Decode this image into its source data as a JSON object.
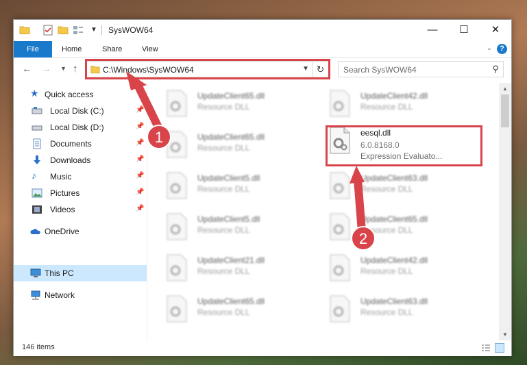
{
  "window": {
    "title": "SysWOW64"
  },
  "ribbon": {
    "tabs": {
      "file": "File",
      "home": "Home",
      "share": "Share",
      "view": "View"
    },
    "accent": "#1979ca"
  },
  "address": {
    "path": "C:\\Windows\\SysWOW64"
  },
  "search": {
    "placeholder": "Search SysWOW64"
  },
  "sidebar": {
    "quick_access": "Quick access",
    "items": [
      {
        "label": "Local Disk (C:)",
        "icon": "drive-icon",
        "pinned": true
      },
      {
        "label": "Local Disk (D:)",
        "icon": "drive-icon",
        "pinned": true
      },
      {
        "label": "Documents",
        "icon": "documents-icon",
        "pinned": true
      },
      {
        "label": "Downloads",
        "icon": "downloads-icon",
        "pinned": true
      },
      {
        "label": "Music",
        "icon": "music-icon",
        "pinned": true
      },
      {
        "label": "Pictures",
        "icon": "pictures-icon",
        "pinned": true
      },
      {
        "label": "Videos",
        "icon": "videos-icon",
        "pinned": true
      }
    ],
    "onedrive": "OneDrive",
    "this_pc": "This PC",
    "network": "Network"
  },
  "files": {
    "left": [
      {
        "name": "UpdateClient65.dll",
        "desc": "Resource DLL"
      },
      {
        "name": "UpdateClient65.dll",
        "desc": "Resource DLL"
      },
      {
        "name": "UpdateClient5.dll",
        "desc": "Resource DLL"
      },
      {
        "name": "UpdateClient5.dll",
        "desc": "Resource DLL"
      },
      {
        "name": "UpdateClient21.dll",
        "desc": "Resource DLL"
      },
      {
        "name": "UpdateClient65.dll",
        "desc": "Resource DLL"
      }
    ],
    "right": [
      {
        "name": "UpdateClient42.dll",
        "desc": "Resource DLL"
      },
      {
        "name": "UpdateClient63.dll",
        "desc": "Resource DLL"
      },
      {
        "name": "UpdateClient65.dll",
        "desc": "Resource DLL"
      },
      {
        "name": "UpdateClient42.dll",
        "desc": "Resource DLL"
      },
      {
        "name": "UpdateClient63.dll",
        "desc": "Resource DLL"
      }
    ],
    "selected": {
      "name": "eesql.dll",
      "version": "6.0.8168.0",
      "desc": "Expression Evaluato..."
    }
  },
  "status": {
    "count": "146 items"
  },
  "annotations": {
    "marker1": "1",
    "marker2": "2",
    "color": "#d9434a"
  }
}
